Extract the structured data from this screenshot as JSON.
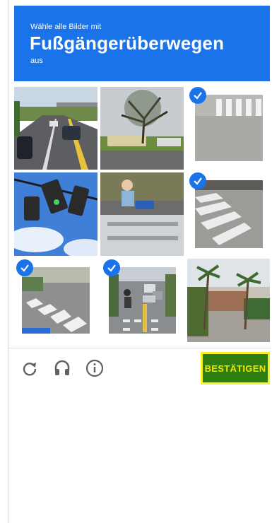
{
  "header": {
    "line1": "Wähle alle Bilder mit",
    "keyword": "Fußgängerüberwegen",
    "line3": "aus"
  },
  "tiles": [
    {
      "row": 1,
      "col": 1,
      "subject": "highway traffic",
      "selected": false
    },
    {
      "row": 1,
      "col": 2,
      "subject": "tree and bus",
      "selected": false
    },
    {
      "row": 1,
      "col": 3,
      "subject": "crosswalk",
      "selected": true
    },
    {
      "row": 2,
      "col": 1,
      "subject": "traffic light",
      "selected": false
    },
    {
      "row": 2,
      "col": 2,
      "subject": "scooter rider",
      "selected": false
    },
    {
      "row": 2,
      "col": 3,
      "subject": "crosswalk",
      "selected": true
    },
    {
      "row": 3,
      "col": 1,
      "subject": "crosswalk",
      "selected": true
    },
    {
      "row": 3,
      "col": 2,
      "subject": "street with cyclist",
      "selected": true
    },
    {
      "row": 3,
      "col": 3,
      "subject": "palm trees",
      "selected": false
    }
  ],
  "controls": {
    "reload_icon": "reload-icon",
    "audio_icon": "headphones-icon",
    "info_icon": "info-icon",
    "verify_label": "BESTÄTIGEN"
  },
  "colors": {
    "header_bg": "#1a73e8",
    "check_bg": "#1a73e8",
    "verify_bg": "#2e7d0e",
    "verify_highlight": "#f7ef2a"
  }
}
